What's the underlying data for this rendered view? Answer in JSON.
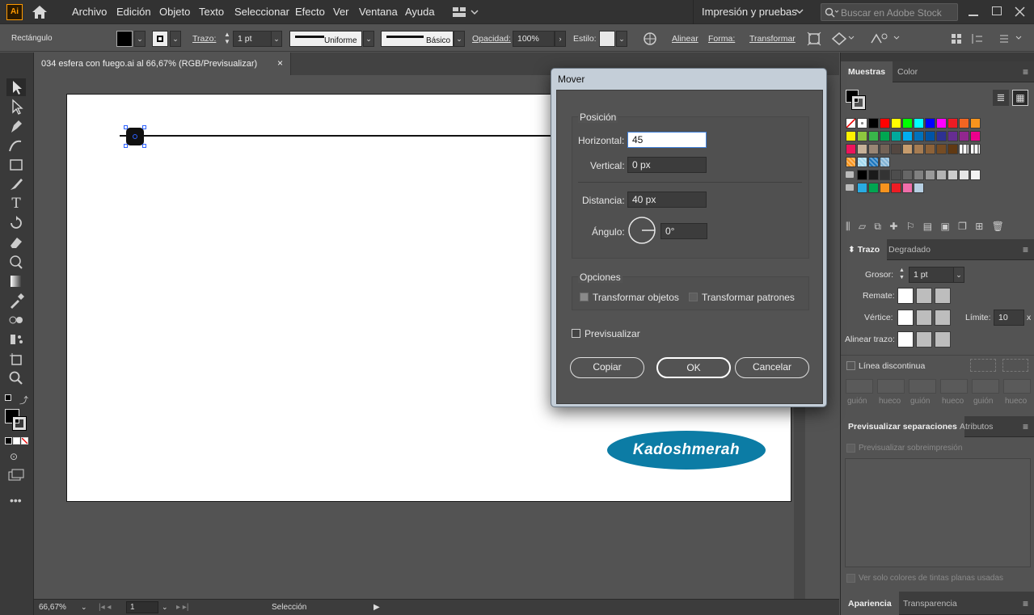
{
  "app": {
    "logo": "Ai",
    "workspace": "Impresión y pruebas",
    "search_placeholder": "Buscar en Adobe Stock"
  },
  "menu": [
    "Archivo",
    "Edición",
    "Objeto",
    "Texto",
    "Seleccionar",
    "Efecto",
    "Ver",
    "Ventana",
    "Ayuda"
  ],
  "control": {
    "object_type": "Rectángulo",
    "stroke_label": "Trazo:",
    "stroke_weight": "1 pt",
    "stroke_profile": "Uniforme",
    "brush": "Básico",
    "opacity_label": "Opacidad:",
    "opacity_value": "100%",
    "style_label": "Estilo:",
    "align_label": "Alinear",
    "shape_label": "Forma:",
    "transform_label": "Transformar"
  },
  "document": {
    "tab_title": "034 esfera con fuego.ai al 66,67% (RGB/Previsualizar)",
    "close": "×",
    "watermark": "Kadoshmerah"
  },
  "status": {
    "zoom": "66,67%",
    "artboard": "1",
    "tool": "Selección"
  },
  "dialog": {
    "title": "Mover",
    "position_group": "Posición",
    "horizontal_label": "Horizontal:",
    "horizontal_value": "45",
    "vertical_label": "Vertical:",
    "vertical_value": "0 px",
    "distance_label": "Distancia:",
    "distance_value": "40 px",
    "angle_label": "Ángulo:",
    "angle_value": "0°",
    "options_group": "Opciones",
    "transform_objects": "Transformar objetos",
    "transform_patterns": "Transformar patrones",
    "preview": "Previsualizar",
    "copy": "Copiar",
    "ok": "OK",
    "cancel": "Cancelar"
  },
  "panels": {
    "swatches_tab": "Muestras",
    "color_tab": "Color",
    "stroke_tab": "Trazo",
    "gradient_tab": "Degradado",
    "weight_label": "Grosor:",
    "weight_value": "1 pt",
    "cap_label": "Remate:",
    "corner_label": "Vértice:",
    "limit_label": "Límite:",
    "limit_value": "10",
    "limit_x": "x",
    "align_stroke_label": "Alinear trazo:",
    "dashed_label": "Línea discontinua",
    "dash_labels": [
      "guión",
      "hueco",
      "guión",
      "hueco",
      "guión",
      "hueco"
    ],
    "sep_tab": "Previsualizar separaciones",
    "attr_tab": "Atributos",
    "overprint": "Previsualizar sobreimpresión",
    "spot_only": "Ver solo colores de tintas planas usadas",
    "appearance_tab": "Apariencia",
    "transparency_tab": "Transparencia"
  },
  "swatch_rows": [
    [
      "#ffffff",
      "#ffffff",
      "#000000",
      "#ff0000",
      "#ffff00",
      "#00ff00",
      "#00ffff",
      "#0000ff",
      "#ff00ff",
      "#ed1c24",
      "#f26522",
      "#f7941d"
    ],
    [
      "#fff200",
      "#8dc63f",
      "#39b54a",
      "#00a651",
      "#00a99d",
      "#00aeef",
      "#0072bc",
      "#0054a6",
      "#2e3192",
      "#662d91",
      "#92278f",
      "#ec008c"
    ],
    [
      "#ed145b",
      "#c7b299",
      "#998675",
      "#736357",
      "#534741",
      "#c69c6d",
      "#a67c52",
      "#8c6239",
      "#754c24",
      "#603913",
      "#ffffff",
      "#ffffff"
    ],
    [
      "#f7941d",
      "#a0d8ef",
      "#1b75bc",
      "#80b3d6"
    ],
    [
      "#000000",
      "#1a1a1a",
      "#333333",
      "#4d4d4d",
      "#666666",
      "#808080",
      "#999999",
      "#b3b3b3",
      "#cccccc",
      "#e6e6e6",
      "#f2f2f2"
    ],
    [
      "#29abe2",
      "#00a651",
      "#f7931e",
      "#ed1c24",
      "#f06eaa",
      "#b6cfe2"
    ]
  ]
}
